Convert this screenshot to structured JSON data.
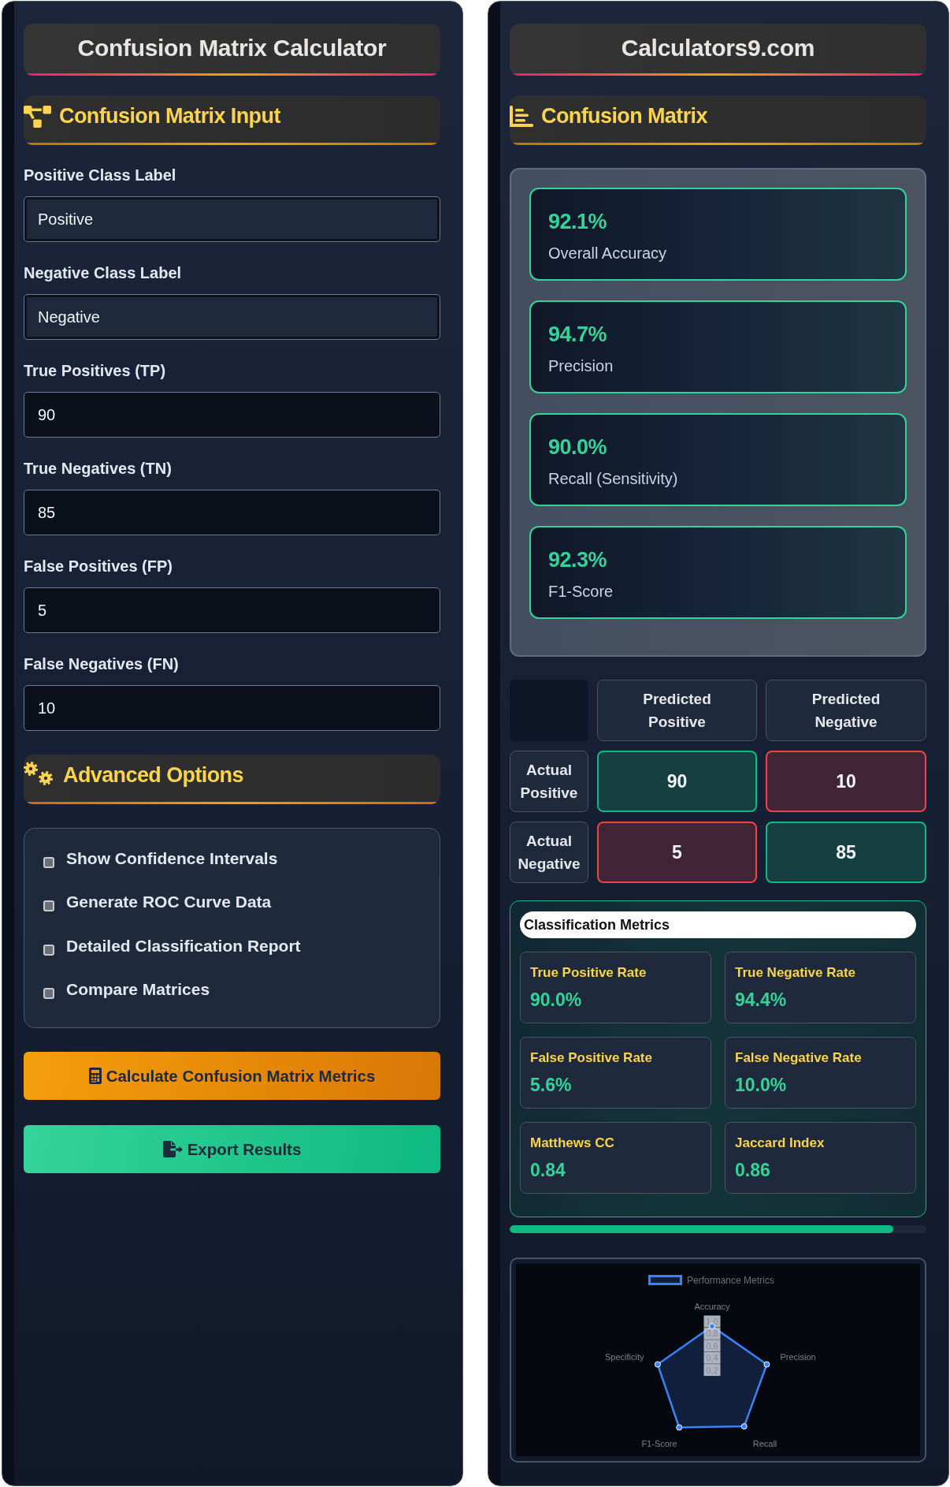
{
  "left_panel": {
    "title": "Confusion Matrix Calculator",
    "input_section": {
      "title": "Confusion Matrix Input",
      "fields": [
        {
          "label": "Positive Class Label",
          "value": "Positive",
          "kind": "text"
        },
        {
          "label": "Negative Class Label",
          "value": "Negative",
          "kind": "text"
        },
        {
          "label": "True Positives (TP)",
          "value": "90",
          "kind": "number"
        },
        {
          "label": "True Negatives (TN)",
          "value": "85",
          "kind": "number"
        },
        {
          "label": "False Positives (FP)",
          "value": "5",
          "kind": "number"
        },
        {
          "label": "False Negatives (FN)",
          "value": "10",
          "kind": "number"
        }
      ]
    },
    "advanced_section": {
      "title": "Advanced Options",
      "options": [
        {
          "label": "Show Confidence Intervals",
          "checked": false
        },
        {
          "label": "Generate ROC Curve Data",
          "checked": false
        },
        {
          "label": "Detailed Classification Report",
          "checked": false
        },
        {
          "label": "Compare Matrices",
          "checked": false
        }
      ]
    },
    "buttons": [
      {
        "label": "Calculate Confusion Matrix Metrics",
        "kind": "calculate"
      },
      {
        "label": "Export Results",
        "kind": "export"
      }
    ]
  },
  "right_panel": {
    "title": "Calculators9.com",
    "results_section": {
      "title": "Confusion Matrix",
      "summary_cards": [
        {
          "value": "92.1%",
          "label": "Overall Accuracy"
        },
        {
          "value": "94.7%",
          "label": "Precision"
        },
        {
          "value": "90.0%",
          "label": "Recall (Sensitivity)"
        },
        {
          "value": "92.3%",
          "label": "F1-Score"
        }
      ]
    },
    "matrix": {
      "column_headers": [
        "Predicted Positive",
        "Predicted Negative"
      ],
      "rows": [
        {
          "header": "Actual Positive",
          "cells": [
            {
              "value": "90",
              "kind": "correct"
            },
            {
              "value": "10",
              "kind": "error"
            }
          ]
        },
        {
          "header": "Actual Negative",
          "cells": [
            {
              "value": "5",
              "kind": "error"
            },
            {
              "value": "85",
              "kind": "correct"
            }
          ]
        }
      ]
    },
    "classification_metrics": {
      "title": "Classification Metrics",
      "items": [
        {
          "label": "True Positive Rate",
          "value": "90.0%"
        },
        {
          "label": "True Negative Rate",
          "value": "94.4%"
        },
        {
          "label": "False Positive Rate",
          "value": "5.6%"
        },
        {
          "label": "False Negative Rate",
          "value": "10.0%"
        },
        {
          "label": "Matthews CC",
          "value": "0.84"
        },
        {
          "label": "Jaccard Index",
          "value": "0.86"
        }
      ]
    },
    "progress": {
      "level": 0.921
    },
    "chart": {
      "legend_label": "Performance Metrics",
      "axis_labels": [
        "Accuracy",
        "Precision",
        "Recall",
        "F1-Score",
        "Specificity"
      ],
      "tick_labels": [
        "1,0",
        "0,8",
        "0,6",
        "0,4",
        "0,2"
      ]
    }
  }
}
